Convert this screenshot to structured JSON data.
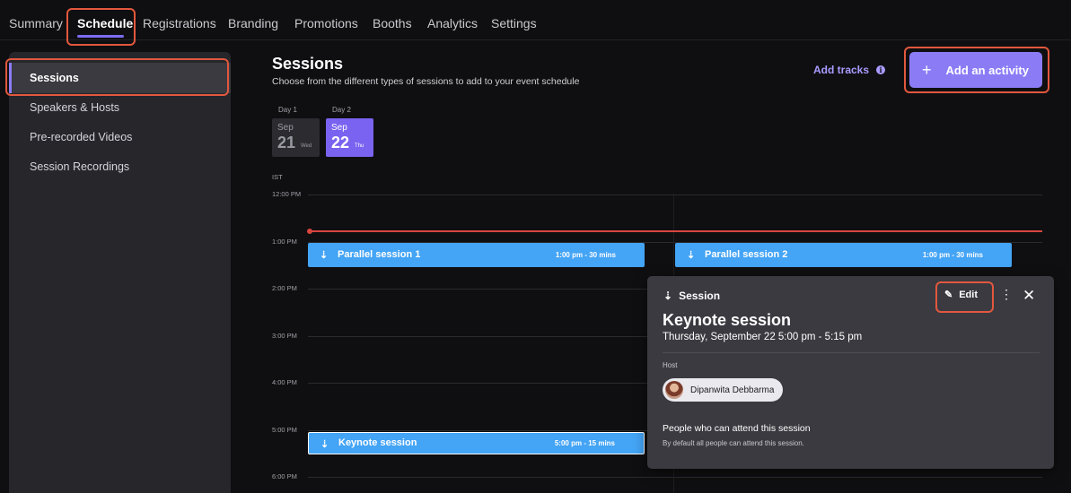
{
  "topnav": {
    "tabs": [
      "Summary",
      "Schedule",
      "Registrations",
      "Branding",
      "Promotions",
      "Booths",
      "Analytics",
      "Settings"
    ],
    "active": "Schedule"
  },
  "sidebar": {
    "items": [
      "Sessions",
      "Speakers & Hosts",
      "Pre-recorded Videos",
      "Session Recordings"
    ],
    "active": "Sessions"
  },
  "header": {
    "title": "Sessions",
    "subtitle": "Choose from the different types of sessions to add to your event schedule",
    "add_tracks": "Add tracks",
    "add_activity": "Add an activity"
  },
  "days": [
    {
      "label": "Day 1",
      "month": "Sep",
      "date": "21",
      "weekday": "Wed"
    },
    {
      "label": "Day 2",
      "month": "Sep",
      "date": "22",
      "weekday": "Thu"
    }
  ],
  "timeline": {
    "timezone": "IST",
    "hours": [
      "12:00 PM",
      "1:00 PM",
      "2:00 PM",
      "3:00 PM",
      "4:00 PM",
      "5:00 PM",
      "6:00 PM"
    ]
  },
  "sessions": [
    {
      "name": "Parallel session 1",
      "time": "1:00 pm - 30 mins"
    },
    {
      "name": "Parallel session 2",
      "time": "1:00 pm - 30 mins"
    },
    {
      "name": "Keynote session",
      "time": "5:00 pm - 15 mins"
    }
  ],
  "popover": {
    "type": "Session",
    "edit": "Edit",
    "title": "Keynote session",
    "date": "Thursday, September 22  5:00 pm - 5:15 pm",
    "host_label": "Host",
    "host_name": "Dipanwita Debbarma",
    "attend_label": "People who can attend this session",
    "attend_sub": "By default all people can attend this session."
  },
  "colors": {
    "accent": "#8b7cf6",
    "session": "#44a4f5",
    "now_line": "#d9453f",
    "highlight": "#e2583e"
  },
  "icons": [
    "plus-icon",
    "info-icon",
    "session-icon",
    "pencil-icon",
    "more-vertical-icon",
    "close-icon"
  ]
}
